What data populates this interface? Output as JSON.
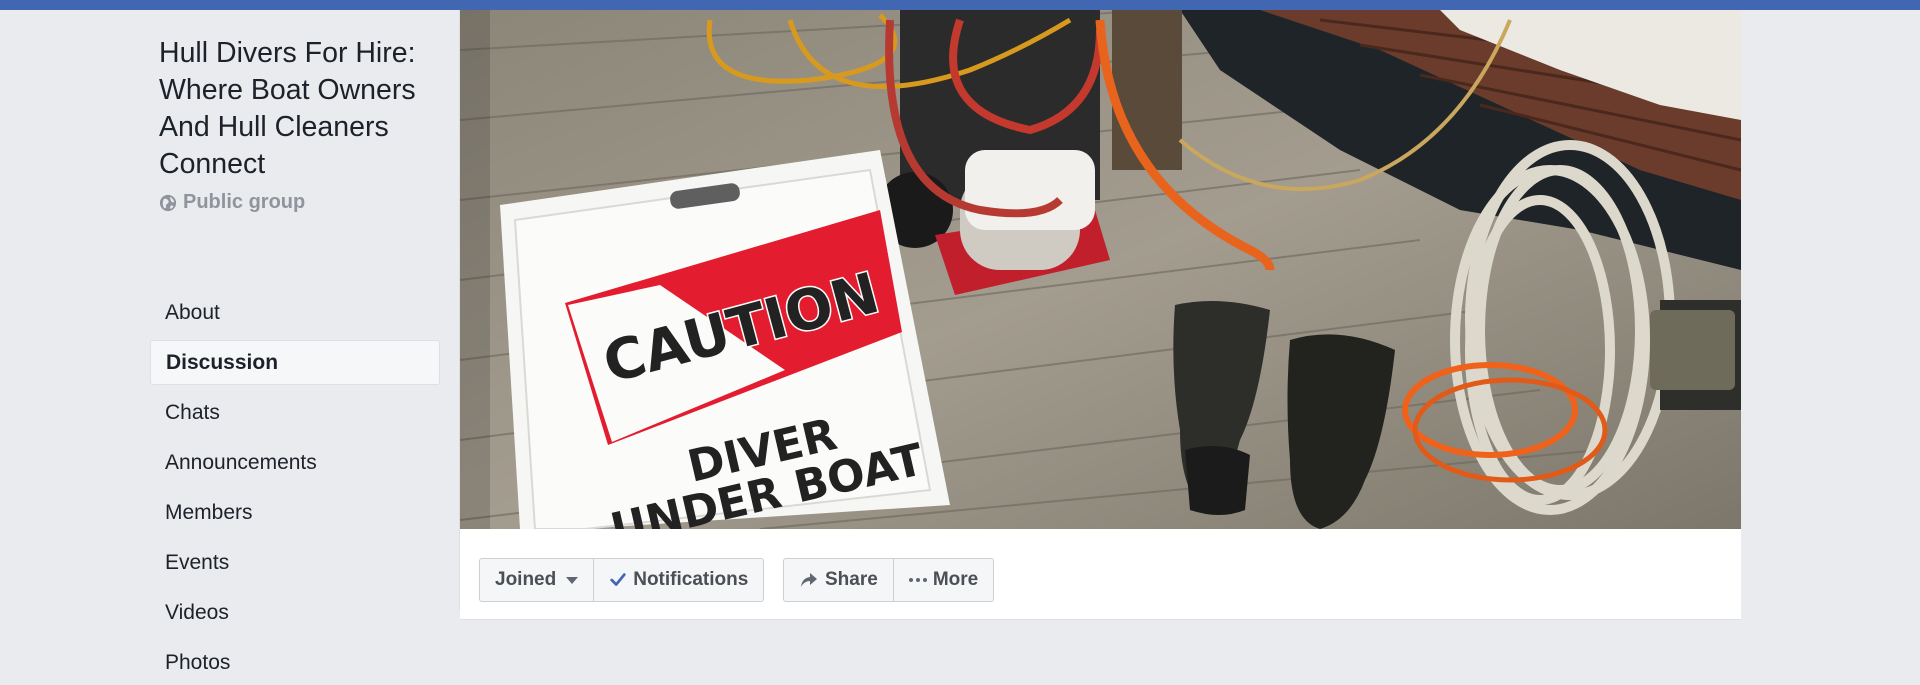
{
  "group": {
    "title": "Hull Divers For Hire: Where Boat Owners And Hull Cleaners Connect",
    "privacy": "Public group"
  },
  "nav": {
    "items": [
      {
        "label": "About"
      },
      {
        "label": "Discussion"
      },
      {
        "label": "Chats"
      },
      {
        "label": "Announcements"
      },
      {
        "label": "Members"
      },
      {
        "label": "Events"
      },
      {
        "label": "Videos"
      },
      {
        "label": "Photos"
      }
    ],
    "active": "Discussion"
  },
  "cover": {
    "sign_top": "CAUTION",
    "sign_line1": "DIVER",
    "sign_line2": "UNDER BOAT"
  },
  "actions": {
    "joined": "Joined",
    "notifications": "Notifications",
    "share": "Share",
    "more": "More"
  },
  "colors": {
    "brand_bar": "#4267b2",
    "page_bg": "#e9ebee",
    "check": "#4267b2"
  }
}
